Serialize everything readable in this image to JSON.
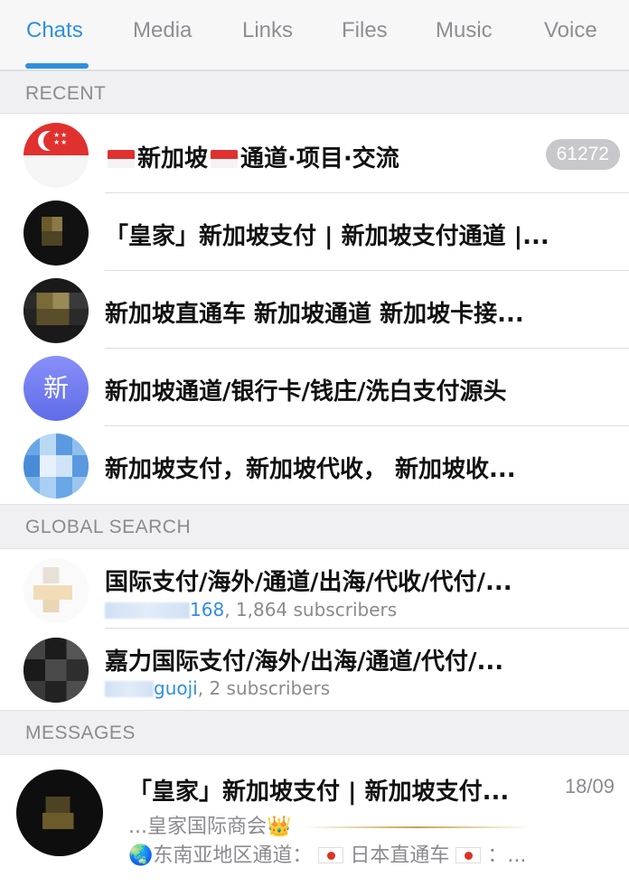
{
  "tabs": [
    "Chats",
    "Media",
    "Links",
    "Files",
    "Music",
    "Voice"
  ],
  "sections": {
    "recent": "RECENT",
    "global": "GLOBAL SEARCH",
    "messages": "MESSAGES"
  },
  "recent": [
    {
      "title_a": "新加坡",
      "title_b": "通道·项目·交流",
      "badge": "61272",
      "avatar": "singapore-flag"
    },
    {
      "title": "「皇家」新加坡支付 | 新加坡支付通道 |...",
      "avatar": "pixelated-dark"
    },
    {
      "title": "新加坡直通车 新加坡通道 新加坡卡接...",
      "avatar": "pixelated-dark"
    },
    {
      "title": "新加坡通道/银行卡/钱庄/洗白支付源头",
      "avatar_letter": "新",
      "avatar_color": "#6a78f0"
    },
    {
      "title": "新加坡支付，新加坡代收， 新加坡收...",
      "avatar": "pixelated-blue"
    }
  ],
  "global": [
    {
      "title": "国际支付/海外/通道/出海/代收/代付/...",
      "username_tail": "168",
      "subscribers": ", 1,864 subscribers"
    },
    {
      "title": "嘉力国际支付/海外/出海/通道/代付/...",
      "username_tail": "guoji",
      "subscribers": ", 2 subscribers"
    }
  ],
  "messages": [
    {
      "title": "「皇家」新加坡支付 | 新加坡支付...",
      "date": "18/09",
      "line1": "...皇家国际商会👑",
      "line2_a": "🌏东南亚地区通道：",
      "line2_b": "日本直通车",
      "line2_c": "：..."
    }
  ],
  "colors": {
    "accent": "#2f8fe0",
    "badge": "#c7c7cc",
    "section_bg": "#f0f0f2"
  }
}
